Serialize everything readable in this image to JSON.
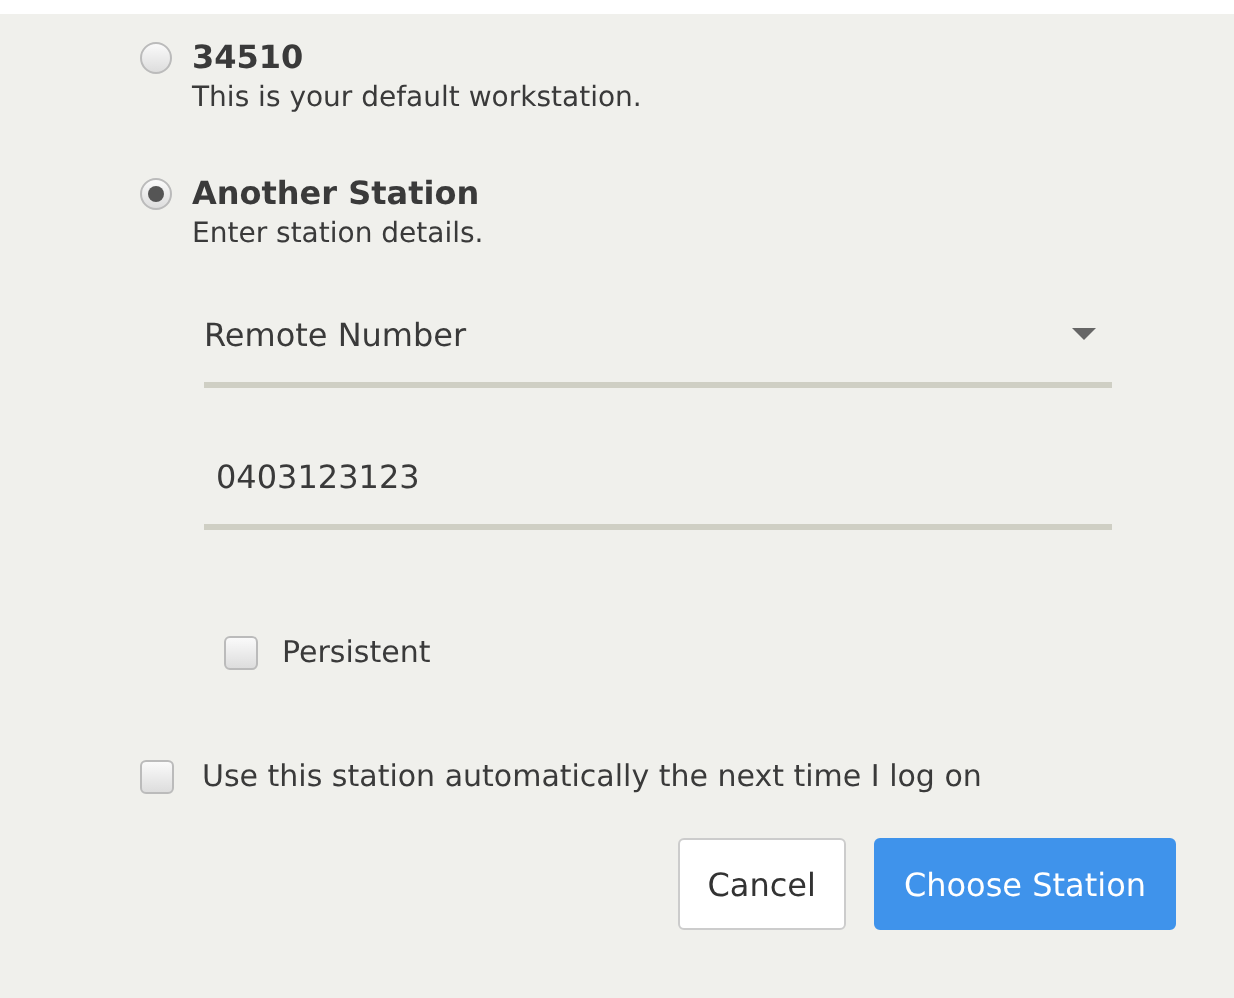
{
  "stations": [
    {
      "title": "34510",
      "description": "This is your default workstation.",
      "selected": false
    },
    {
      "title": "Another Station",
      "description": "Enter station details.",
      "selected": true
    }
  ],
  "station_type": {
    "value": "Remote Number"
  },
  "remote_number": {
    "value": "0403123123"
  },
  "persistent": {
    "label": "Persistent",
    "checked": false
  },
  "auto_use": {
    "label": "Use this station automatically the next time I log on",
    "checked": false
  },
  "buttons": [
    {
      "label": "Cancel",
      "kind": "secondary"
    },
    {
      "label": "Choose Station",
      "kind": "primary"
    }
  ]
}
